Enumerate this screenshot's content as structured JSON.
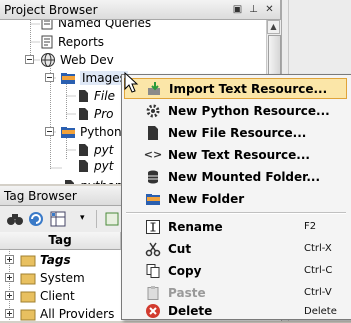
{
  "project_browser": {
    "title": "Project Browser",
    "items": [
      {
        "label": "Named Queries"
      },
      {
        "label": "Reports"
      },
      {
        "label": "Web Dev"
      },
      {
        "label": "Images"
      },
      {
        "label": "File"
      },
      {
        "label": "Pro"
      },
      {
        "label": "Python"
      },
      {
        "label": "pyt"
      },
      {
        "label": "pyt"
      },
      {
        "label": "python"
      }
    ]
  },
  "tag_browser": {
    "title": "Tag Browser",
    "column_header": "Tag",
    "items": [
      {
        "label": "Tags"
      },
      {
        "label": "System"
      },
      {
        "label": "Client"
      },
      {
        "label": "All Providers"
      }
    ]
  },
  "context_menu": {
    "items": [
      {
        "label": "Import Text Resource...",
        "icon": "import-icon",
        "highlighted": true
      },
      {
        "label": "New Python Resource...",
        "icon": "python-gear-icon"
      },
      {
        "label": "New File Resource...",
        "icon": "file-icon"
      },
      {
        "label": "New Text Resource...",
        "icon": "code-brackets-icon"
      },
      {
        "label": "New Mounted Folder...",
        "icon": "database-icon"
      },
      {
        "label": "New Folder",
        "icon": "folder-icon"
      },
      {
        "label": "Rename",
        "icon": "rename-icon",
        "shortcut": "F2"
      },
      {
        "label": "Cut",
        "icon": "scissors-icon",
        "shortcut": "Ctrl-X"
      },
      {
        "label": "Copy",
        "icon": "copy-icon",
        "shortcut": "Ctrl-C"
      },
      {
        "label": "Paste",
        "icon": "paste-icon",
        "shortcut": "Ctrl-V",
        "disabled": true
      },
      {
        "label": "Delete",
        "icon": "delete-icon",
        "shortcut": "Delete"
      }
    ]
  },
  "colors": {
    "highlight_bg": "#fbe6a8",
    "highlight_border": "#e0a43a",
    "folder_blue": "#2a5fb0",
    "folder_orange": "#f2a23a",
    "delete_red": "#d23b2e"
  }
}
